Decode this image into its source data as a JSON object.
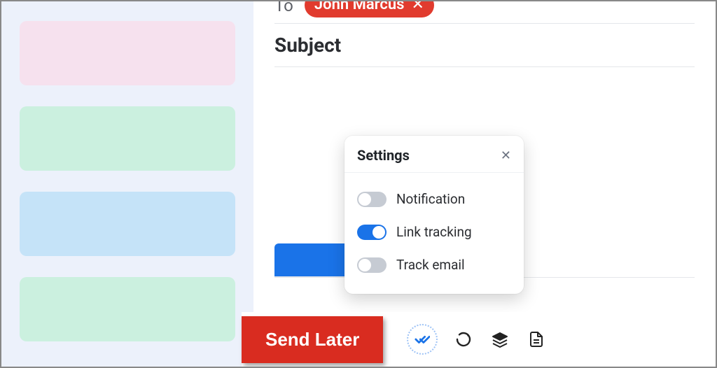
{
  "sidebar": {
    "blocks": [
      {
        "color": "b1"
      },
      {
        "color": "b2"
      },
      {
        "color": "b3"
      },
      {
        "color": "b4"
      }
    ]
  },
  "compose": {
    "to_label": "To",
    "recipient": {
      "name": "John Marcus"
    },
    "subject_placeholder": "Subject"
  },
  "popover": {
    "title": "Settings",
    "options": [
      {
        "label": "Notification",
        "enabled": false
      },
      {
        "label": "Link tracking",
        "enabled": true
      },
      {
        "label": "Track email",
        "enabled": false
      }
    ]
  },
  "actions": {
    "send_later_label": "Send Later",
    "icons": [
      {
        "name": "double-check-icon",
        "active": true
      },
      {
        "name": "refresh-icon",
        "active": false
      },
      {
        "name": "layers-icon",
        "active": false
      },
      {
        "name": "document-icon",
        "active": false
      }
    ]
  }
}
